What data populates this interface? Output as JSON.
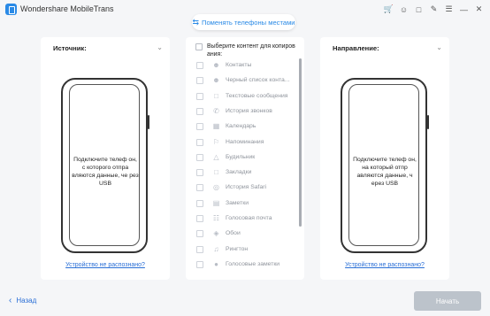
{
  "app": {
    "title": "Wondershare MobileTrans",
    "window_icons": [
      "cart-icon",
      "user-icon",
      "chat-icon",
      "pen-icon",
      "menu-icon",
      "minimize-icon",
      "close-icon"
    ]
  },
  "swap": {
    "label": "Поменять телефоны местами"
  },
  "source": {
    "header": "Источник:",
    "phone_text": "Подключите телеф он, с которого отпра вляются данные, че рез USB",
    "link": "Устройство не распознано?"
  },
  "destination": {
    "header": "Направление:",
    "phone_text": "Подключите телеф он, на который отпр авляются данные, ч ерез USB",
    "link": "Устройство не распознано?"
  },
  "content": {
    "select_all": "Выберите контент для копиров ания:",
    "items": [
      {
        "label": "Контакты",
        "icon": "contact-icon"
      },
      {
        "label": "Черный список конта...",
        "icon": "blocked-contact-icon"
      },
      {
        "label": "Текстовые сообщения",
        "icon": "message-icon"
      },
      {
        "label": "История звонков",
        "icon": "phone-icon"
      },
      {
        "label": "Календарь",
        "icon": "calendar-icon"
      },
      {
        "label": "Напоминания",
        "icon": "flag-icon"
      },
      {
        "label": "Будильник",
        "icon": "alarm-icon"
      },
      {
        "label": "Закладки",
        "icon": "bookmark-icon"
      },
      {
        "label": "История Safari",
        "icon": "compass-icon"
      },
      {
        "label": "Заметки",
        "icon": "note-icon"
      },
      {
        "label": "Голосовая почта",
        "icon": "voicemail-icon"
      },
      {
        "label": "Обои",
        "icon": "layers-icon"
      },
      {
        "label": "Рингтон",
        "icon": "bell-icon"
      },
      {
        "label": "Голосовые заметки",
        "icon": "mic-icon"
      }
    ]
  },
  "footer": {
    "back_label": "Назад",
    "start_label": "Начать"
  },
  "colors": {
    "accent": "#2a8ae6",
    "link": "#2a6fd6",
    "start_disabled": "#bcc3cb",
    "background": "#f5f6f8"
  }
}
